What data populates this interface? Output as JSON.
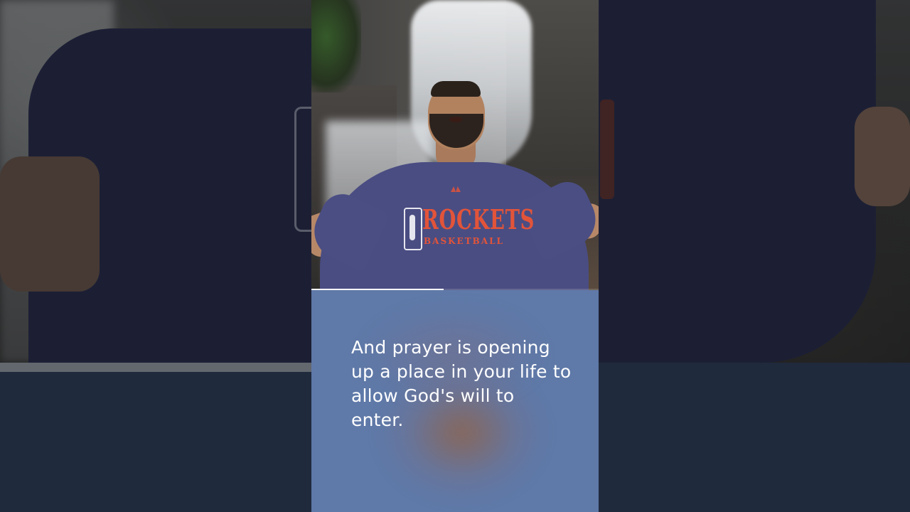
{
  "video": {
    "shirt_text_main": "ROCKETS",
    "shirt_text_sub": "BASKETBALL",
    "logo_text": "NBA",
    "progress_fraction": 0.46
  },
  "caption": {
    "text": "And prayer is opening up a place in your life to allow God's will to enter."
  },
  "colors": {
    "caption_bg": "#5f79a8",
    "page_bg": "#1f2a3d",
    "shirt": "#4a4d82",
    "shirt_print": "#e2543a"
  },
  "icons": [
    "nba-logo-icon",
    "adidas-logo-icon"
  ]
}
